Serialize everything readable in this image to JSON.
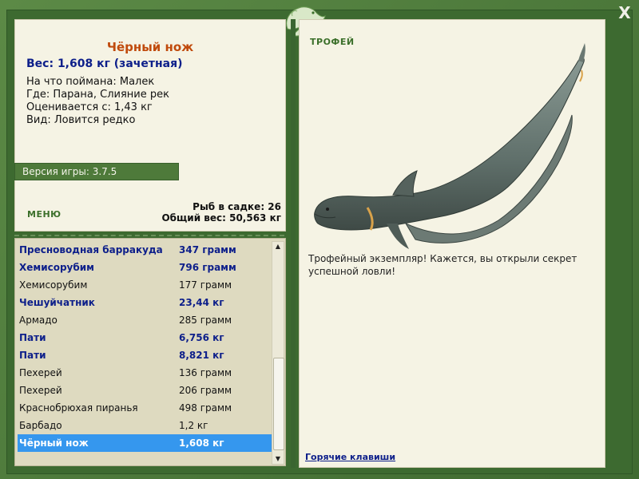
{
  "window": {
    "close_label": "X"
  },
  "fish_info": {
    "name": "Чёрный нож",
    "weight": "Вес: 1,608 кг (зачетная)",
    "details": [
      "На что поймана: Малек",
      "Где: Парана, Слияние рек",
      "Оценивается с: 1,43 кг",
      "Вид: Ловится редко"
    ]
  },
  "version": {
    "label": "Версия игры: 3.7.5"
  },
  "menu": {
    "label": "МЕНЮ"
  },
  "keepnet": {
    "count": "Рыб в садке: 26",
    "total_weight": "Общий вес: 50,563 кг"
  },
  "catch_list": [
    {
      "name": "Пресноводная барракуда",
      "weight": "347 грамм",
      "trophy": true
    },
    {
      "name": "Хемисорубим",
      "weight": "796 грамм",
      "trophy": true
    },
    {
      "name": "Хемисорубим",
      "weight": "177 грамм",
      "trophy": false
    },
    {
      "name": "Чешуйчатник",
      "weight": "23,44 кг",
      "trophy": true
    },
    {
      "name": "Армадо",
      "weight": "285 грамм",
      "trophy": false
    },
    {
      "name": "Пати",
      "weight": "6,756 кг",
      "trophy": true
    },
    {
      "name": "Пати",
      "weight": "8,821 кг",
      "trophy": true
    },
    {
      "name": "Пехерей",
      "weight": "136 грамм",
      "trophy": false
    },
    {
      "name": "Пехерей",
      "weight": "206 грамм",
      "trophy": false
    },
    {
      "name": "Краснобрюхая пиранья",
      "weight": "498 грамм",
      "trophy": false
    },
    {
      "name": "Барбадо",
      "weight": "1,2 кг",
      "trophy": false
    },
    {
      "name": "Чёрный нож",
      "weight": "1,608 кг",
      "trophy": true,
      "selected": true
    }
  ],
  "trophy_panel": {
    "label": "ТРОФЕЙ",
    "message": "Трофейный экземпляр! Кажется, вы открыли секрет успешной ловли!",
    "hotkeys_link": "Горячие клавиши"
  },
  "colors": {
    "frame": "#4a7a3a",
    "panel": "#f5f3e4",
    "list_bg": "#dedac0",
    "trophy_text": "#0d1f8a",
    "fish_name": "#c04a0c",
    "selection": "#3597ee",
    "accent_green": "#3b6f2a"
  },
  "icons": {
    "logo": "lizard-logo-icon",
    "close": "close-icon",
    "scroll_up": "arrow-up-icon",
    "scroll_down": "arrow-down-icon"
  }
}
